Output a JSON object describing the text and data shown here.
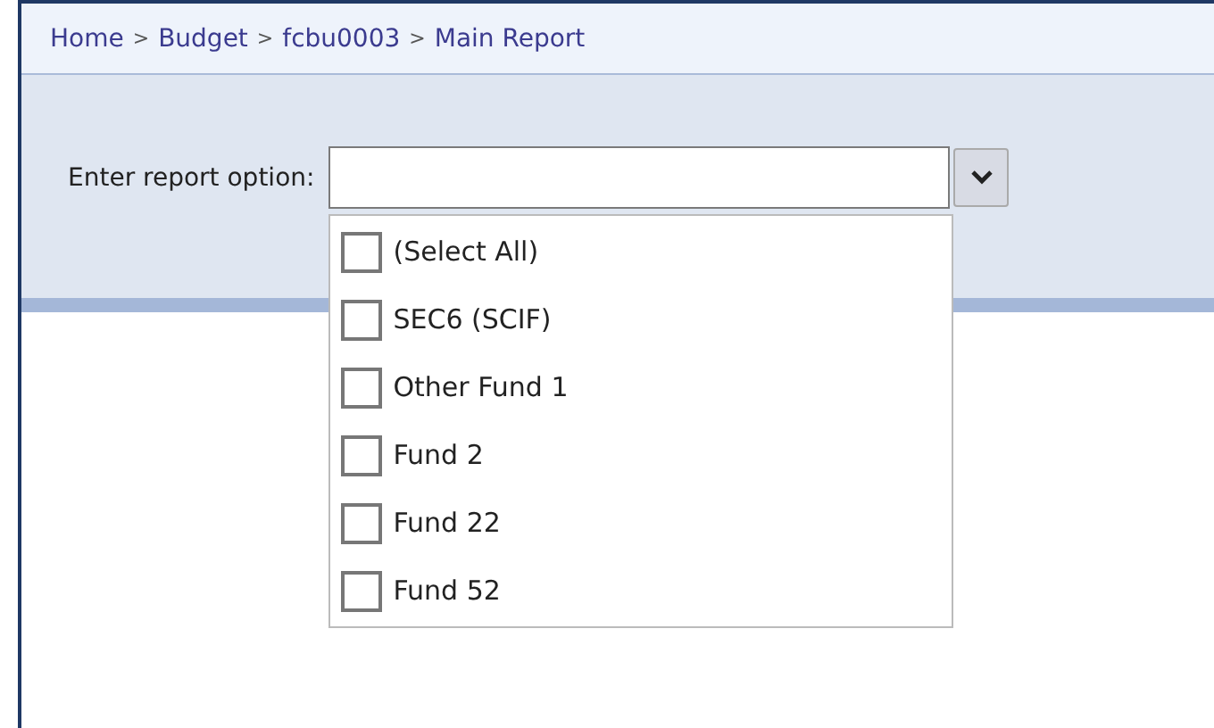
{
  "breadcrumb": {
    "separator": ">",
    "items": [
      {
        "label": "Home"
      },
      {
        "label": "Budget"
      },
      {
        "label": "fcbu0003"
      },
      {
        "label": "Main Report"
      }
    ]
  },
  "report_option": {
    "label": "Enter report option:",
    "expanded": true,
    "options": [
      {
        "label": "(Select All)",
        "checked": false
      },
      {
        "label": "SEC6 (SCIF)",
        "checked": false
      },
      {
        "label": "Other Fund 1",
        "checked": false
      },
      {
        "label": "Fund 2",
        "checked": false
      },
      {
        "label": "Fund 22",
        "checked": false
      },
      {
        "label": "Fund 52",
        "checked": false
      }
    ]
  }
}
